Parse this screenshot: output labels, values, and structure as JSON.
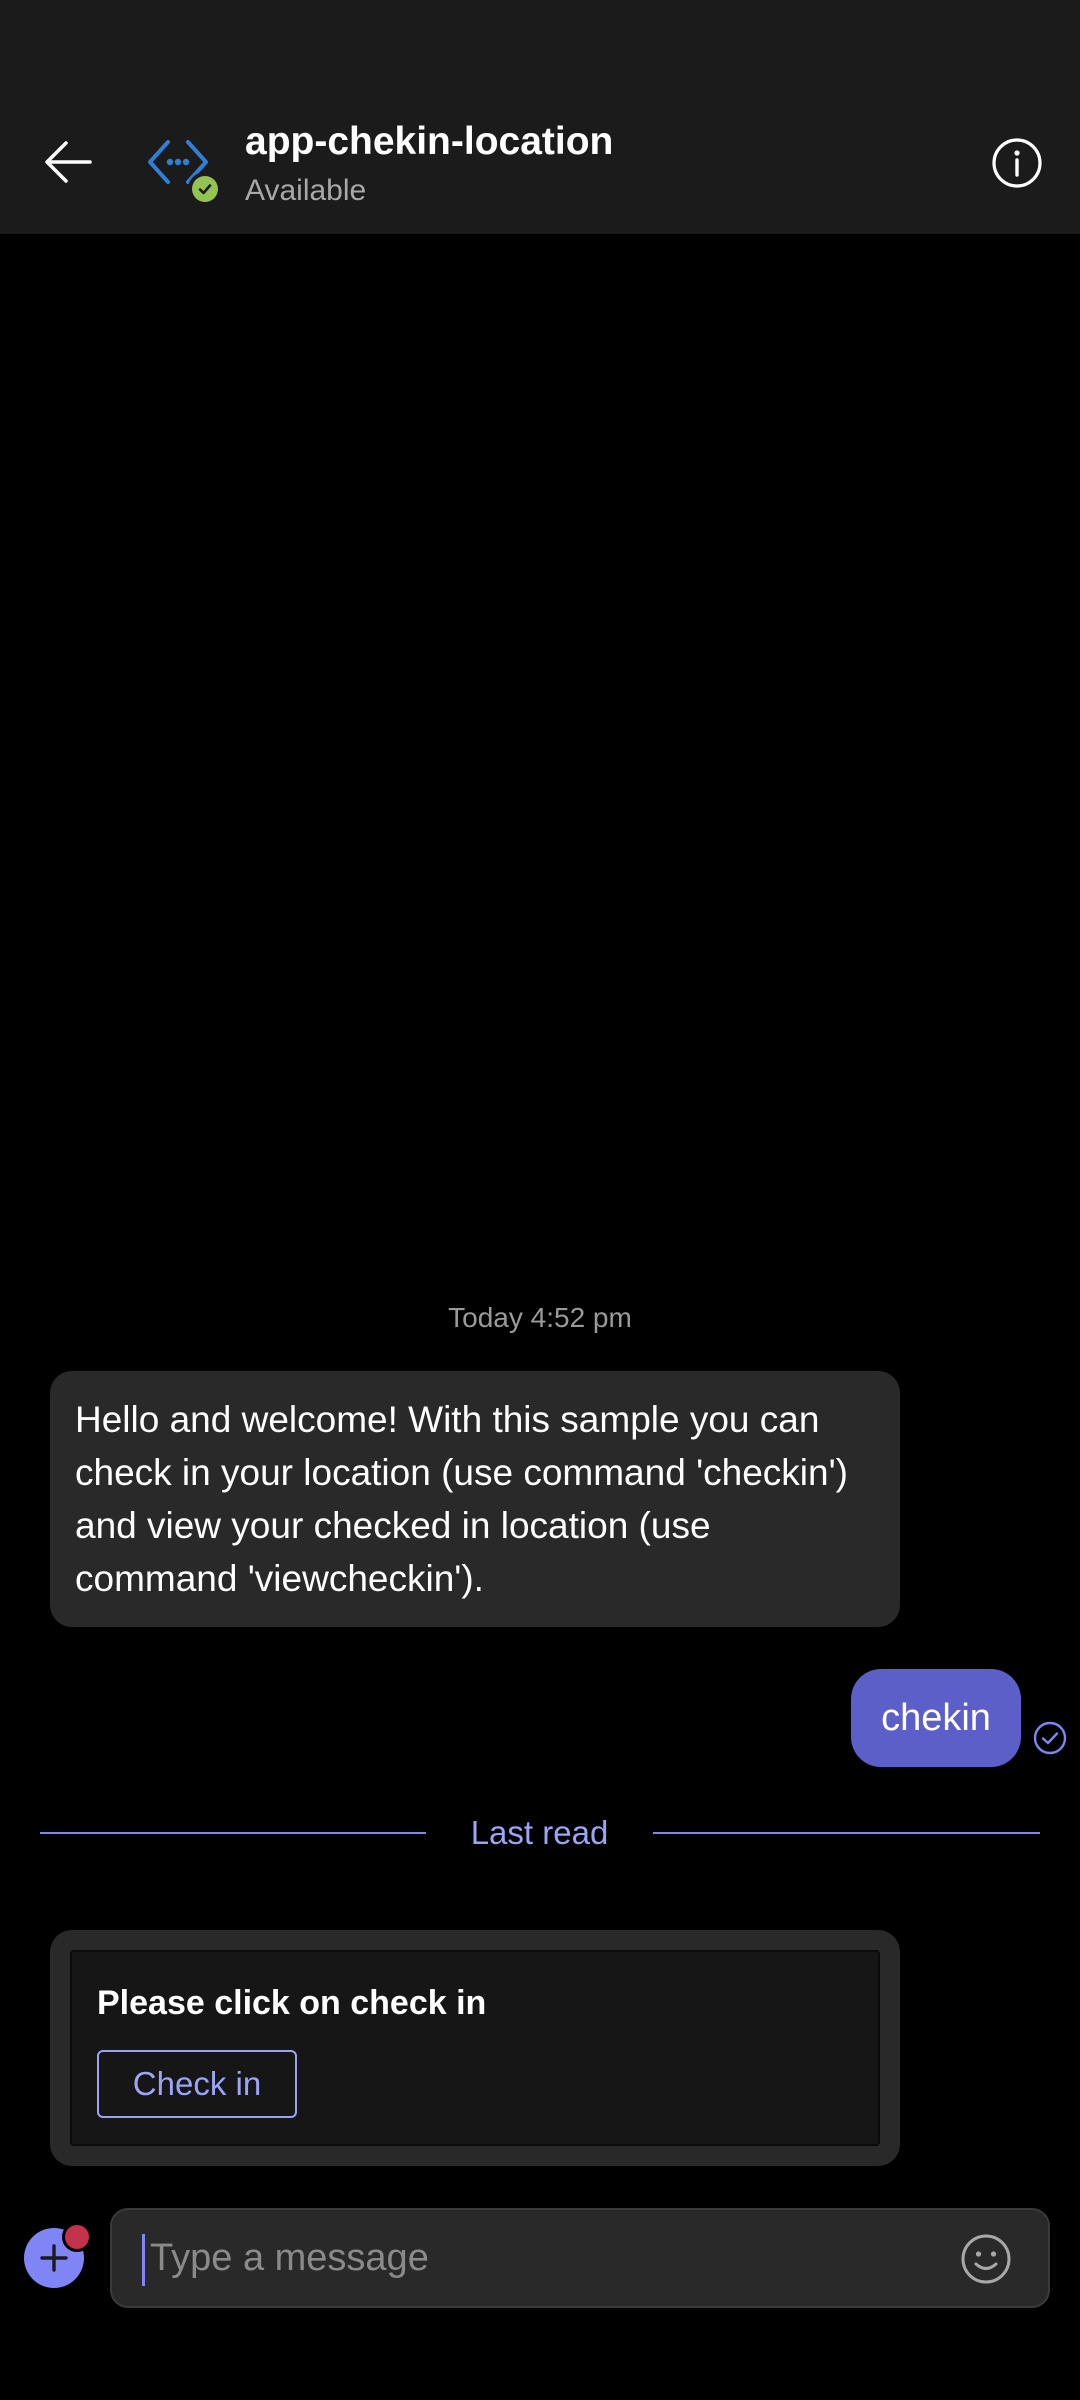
{
  "header": {
    "title": "app-chekin-location",
    "status": "Available"
  },
  "messages": {
    "timestamp": "Today 4:52 pm",
    "bot_welcome": "Hello and welcome! With this sample you can check in your location (use command 'checkin') and view your checked in location (use command 'viewcheckin').",
    "user_message": "chekin",
    "last_read_label": "Last read",
    "card": {
      "text": "Please click on check in",
      "action_label": "Check in"
    }
  },
  "compose": {
    "placeholder": "Type a message"
  },
  "icons": {
    "back": "arrow-left-icon",
    "app_avatar": "app-code-icon",
    "presence": "available-check-icon",
    "info": "info-icon",
    "sent": "sent-check-icon",
    "add": "plus-icon",
    "emoji": "smiley-icon"
  },
  "colors": {
    "accent": "#5b5fc7",
    "accent_light": "#7f85f5",
    "available": "#92c353",
    "notification": "#c4314b"
  }
}
